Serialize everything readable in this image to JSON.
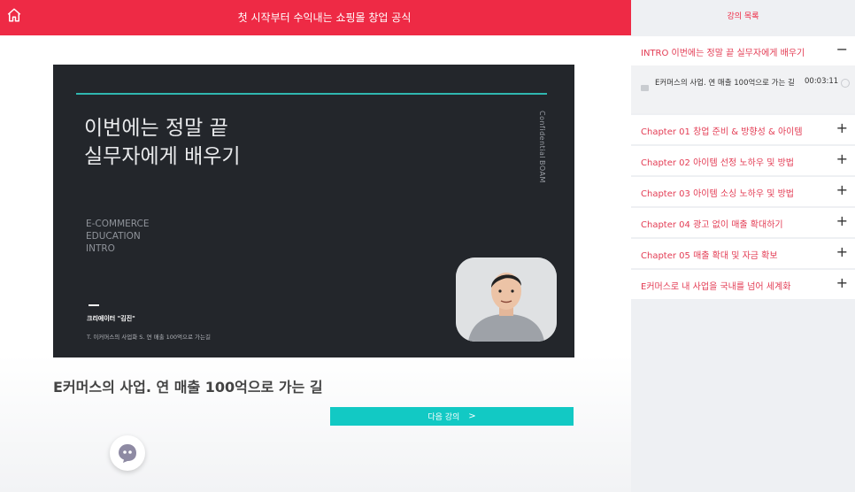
{
  "header": {
    "title": "첫 시작부터 수익내는 쇼핑몰 창업 공식"
  },
  "video": {
    "title_line1": "이번에는 정말 끝",
    "title_line2": "실무자에게 배우기",
    "side_text1": "Confidential",
    "side_text2": "BOAM",
    "ec_line1": "E-COMMERCE",
    "ec_line2": "EDUCATION",
    "ec_line3": "INTRO",
    "creator": "크리에이터 \"김진\"",
    "subtitle": "T. 이커머스의 사업화    S. 연 매출 100억으로 가는길"
  },
  "lecture": {
    "title": "E커머스의 사업. 연 매출 100억으로 가는 길"
  },
  "next_button": {
    "label": "다음 강의",
    "arrow": ">"
  },
  "sidebar": {
    "heading": "강의 목록",
    "sections": [
      {
        "label": "INTRO 이번에는 정말 끝 실무자에게 배우기",
        "toggle": "−"
      },
      {
        "label": "Chapter 01 창업 준비 & 방향성 & 아이템",
        "toggle": "+"
      },
      {
        "label": "Chapter 02 아이템 선정 노하우 및 방법",
        "toggle": "+"
      },
      {
        "label": "Chapter 03 아이템 소싱 노하우 및 방법",
        "toggle": "+"
      },
      {
        "label": "Chapter 04 광고 없이 매출 확대하기",
        "toggle": "+"
      },
      {
        "label": "Chapter 05 매출 확대 및 자금 확보",
        "toggle": "+"
      },
      {
        "label": "E커머스로 내 사업을 국내를 넘어 세계화",
        "toggle": "+"
      }
    ],
    "lesson": {
      "name": "E커머스의 사업. 연 매출 100억으로 가는 길",
      "duration": "00:03:11"
    }
  },
  "icons": {
    "home": "home-icon",
    "chat": "chat-bot-icon",
    "play": "video-icon",
    "status": "incomplete-circle-icon"
  },
  "colors": {
    "brand_red": "#ee2a45",
    "teal": "#12c9c4",
    "sidebar_bg": "#eef0f3"
  }
}
